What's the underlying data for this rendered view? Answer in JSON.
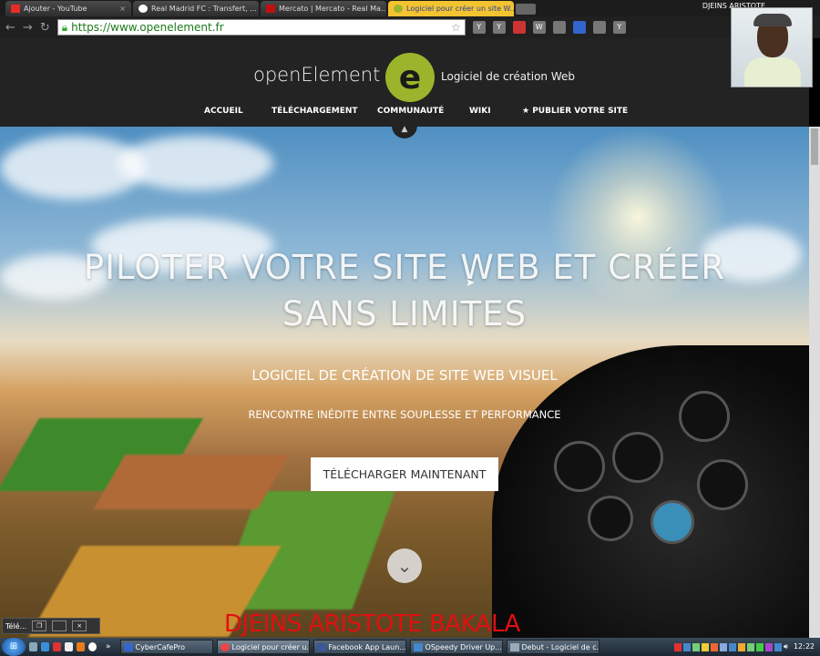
{
  "browser": {
    "tabs": [
      {
        "label": "Ajouter - YouTube",
        "color": "#e52d27"
      },
      {
        "label": "Real Madrid FC : Transfert, ...",
        "color": "#ffffff"
      },
      {
        "label": "Mercato | Mercato - Real Ma...",
        "color": "#c01010"
      },
      {
        "label": "Logiciel pour créer un site W...",
        "color": "#9ab52b"
      }
    ],
    "window_title": "DJEINS ARISTOTE",
    "url": "https://www.openelement.fr",
    "extensions": [
      "Y",
      "Y",
      "W",
      "Y"
    ]
  },
  "site": {
    "logo_text": "openElement",
    "logo_letter": "e",
    "tagline": "Logiciel de création Web",
    "nav": [
      "ACCUEIL",
      "TÉLÉCHARGEMENT",
      "COMMUNAUTÉ",
      "WIKI",
      "★ PUBLIER VOTRE SITE"
    ],
    "hero_title_line1": "PILOTER VOTRE SITE WEB ET CRÉER",
    "hero_title_line2": "SANS LIMITES",
    "hero_subtitle": "LOGICIEL DE CRÉATION DE SITE WEB VISUEL",
    "hero_tagline": "RENCONTRE INÉDITE ENTRE SOUPLESSE ET PERFORMANCE",
    "cta": "TÉLÉCHARGER MAINTENANT",
    "accent": "#9ab52b"
  },
  "overlay": {
    "watermark": "DJEINS ARISTOTE BAKALA",
    "minibar_label": "Télé..."
  },
  "taskbar": {
    "tasks": [
      "CyberCafePro",
      "Logiciel pour créer u...",
      "Facebook App Laun...",
      "OSpeedy Driver Up...",
      "Debut - Logiciel de c..."
    ],
    "clock": "12:22"
  }
}
